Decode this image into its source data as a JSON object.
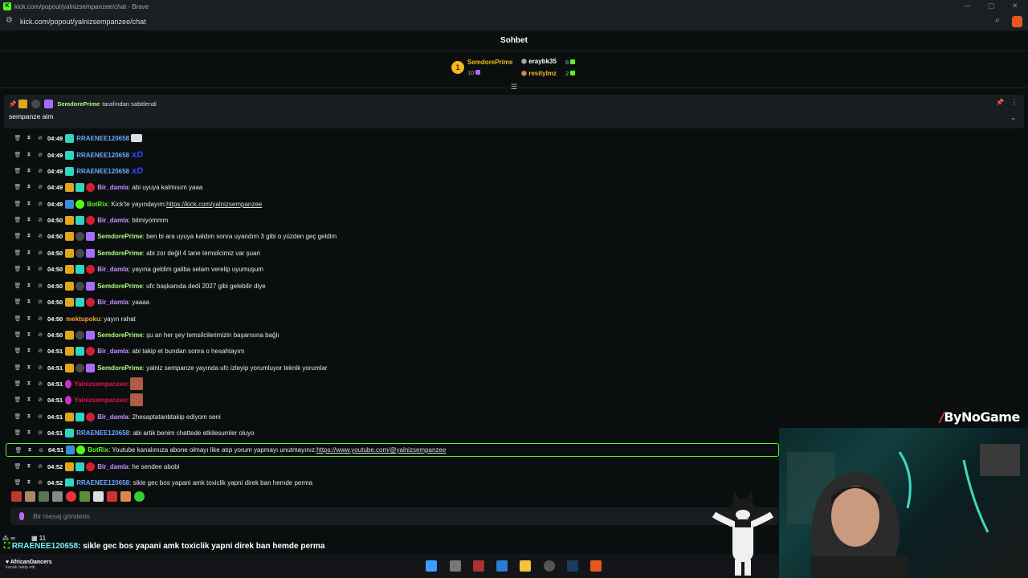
{
  "window": {
    "title": "kick.com/popout/yalnizsempanzee/chat - Brave",
    "url": "kick.com/popout/yalnizsempanzee/chat"
  },
  "chat_title": "Sohbet",
  "leaderboard": {
    "rank": "1",
    "first": {
      "name": "SemdorePrime",
      "count": "10"
    },
    "second": {
      "name": "eraybk35",
      "count": "8"
    },
    "third": {
      "name": "resityImz",
      "count": "2"
    }
  },
  "pinned": {
    "user": "SemdorePrime",
    "suffix": "tarafından sabitlendi",
    "message": "sempanze aim"
  },
  "messages": [
    {
      "time": "04:49",
      "user": "RRAENEE120658",
      "color": "#6ea8ff",
      "badges": [
        "vip"
      ],
      "text": ""
    },
    {
      "time": "04:49",
      "user": "RRAENEE120658",
      "color": "#6ea8ff",
      "badges": [
        "vip"
      ],
      "text": ""
    },
    {
      "time": "04:49",
      "user": "RRAENEE120658",
      "color": "#6ea8ff",
      "badges": [
        "vip"
      ],
      "text": ""
    },
    {
      "time": "04:49",
      "user": "Bir_damla",
      "color": "#c990ff",
      "badges": [
        "crown",
        "vip",
        "heart"
      ],
      "text": ": abi uyuya kalmısım yaaa"
    },
    {
      "time": "04:49",
      "user": "BotRix",
      "color": "#53fc18",
      "badges": [
        "pick",
        "bot"
      ],
      "text": ": Kick'te yayındayım: ",
      "link": "https://kick.com/yalnizsempanzee"
    },
    {
      "time": "04:50",
      "user": "Bir_damla",
      "color": "#c990ff",
      "badges": [
        "crown",
        "vip",
        "heart"
      ],
      "text": ": bilmiyommm"
    },
    {
      "time": "04:50",
      "user": "SemdorePrime",
      "color": "#a8ff7a",
      "badges": [
        "crown",
        "hand",
        "gift"
      ],
      "text": ": ben bi ara uyuya kaldım sonra uyandım 3 gibi o yüzden geç geldim"
    },
    {
      "time": "04:50",
      "user": "SemdorePrime",
      "color": "#a8ff7a",
      "badges": [
        "crown",
        "hand",
        "gift"
      ],
      "text": ": abi zor değil 4 tane temsilcimiz var şuan"
    },
    {
      "time": "04:50",
      "user": "Bir_damla",
      "color": "#c990ff",
      "badges": [
        "crown",
        "vip",
        "heart"
      ],
      "text": ": yayına geldim galiba selam verelip uyumuşum"
    },
    {
      "time": "04:50",
      "user": "SemdorePrime",
      "color": "#a8ff7a",
      "badges": [
        "crown",
        "hand",
        "gift"
      ],
      "text": ": ufc başkanıda dedi 2027 gibi gelebilir diye"
    },
    {
      "time": "04:50",
      "user": "Bir_damla",
      "color": "#c990ff",
      "badges": [
        "crown",
        "vip",
        "heart"
      ],
      "text": ": yaaaa"
    },
    {
      "time": "04:50",
      "user": "mektupoku",
      "color": "#ff9f3a",
      "badges": [],
      "text": ": yayın rahat"
    },
    {
      "time": "04:50",
      "user": "SemdorePrime",
      "color": "#a8ff7a",
      "badges": [
        "crown",
        "hand",
        "gift"
      ],
      "text": ": şu an her şey temsilcilerimizin başarısına bağlı"
    },
    {
      "time": "04:51",
      "user": "Bir_damla",
      "color": "#c990ff",
      "badges": [
        "crown",
        "vip",
        "heart"
      ],
      "text": ": abi takip et bundan sonra o hesahtayım"
    },
    {
      "time": "04:51",
      "user": "SemdorePrime",
      "color": "#a8ff7a",
      "badges": [
        "crown",
        "hand",
        "gift"
      ],
      "text": ": yalniz sempanze yayında ufc izleyip yorumluyor teknik yorumlar"
    },
    {
      "time": "04:51",
      "user": "Yalnizsempanzee",
      "color": "#e5134a",
      "badges": [
        "mic"
      ],
      "text": ":"
    },
    {
      "time": "04:51",
      "user": "Yalnizsempanzee",
      "color": "#e5134a",
      "badges": [
        "mic"
      ],
      "text": ":"
    },
    {
      "time": "04:51",
      "user": "Bir_damla",
      "color": "#c990ff",
      "badges": [
        "crown",
        "vip",
        "heart"
      ],
      "text": ": 2hesaptatanbtakip ediyom seni"
    },
    {
      "time": "04:51",
      "user": "RRAENEE120658",
      "color": "#6ea8ff",
      "badges": [
        "vip"
      ],
      "text": ": abi artik benim chattede etkilesumler oluyo"
    },
    {
      "time": "04:51",
      "user": "BotRix",
      "color": "#53fc18",
      "badges": [
        "pick",
        "bot"
      ],
      "text": ": Youtube kanalımıza abone olmayı like atıp yorum yapmayı unutmayınız: ",
      "link": "https://www.youtube.com/@yalnizsempanzee"
    },
    {
      "time": "04:52",
      "user": "Bir_damla",
      "color": "#c990ff",
      "badges": [
        "crown",
        "vip",
        "heart"
      ],
      "text": ": he sendee abobi"
    },
    {
      "time": "04:52",
      "user": "RRAENEE120658",
      "color": "#6ea8ff",
      "badges": [
        "vip"
      ],
      "text": ": sikle gec bos yapani amk toxiclik yapni direk ban hemde perma"
    }
  ],
  "input_placeholder": "Bir mesaj gönderin",
  "stats": {
    "viewers_icon": "∞",
    "count": "11"
  },
  "banner": {
    "user": "RRAENEE120658",
    "text": ": sikle gec bos yapani amk toxiclik yapni direk ban hemde perma"
  },
  "follower": {
    "name": "AfricanDancers",
    "sub": "kanalı takip etti"
  },
  "logo": "ByNoGame"
}
